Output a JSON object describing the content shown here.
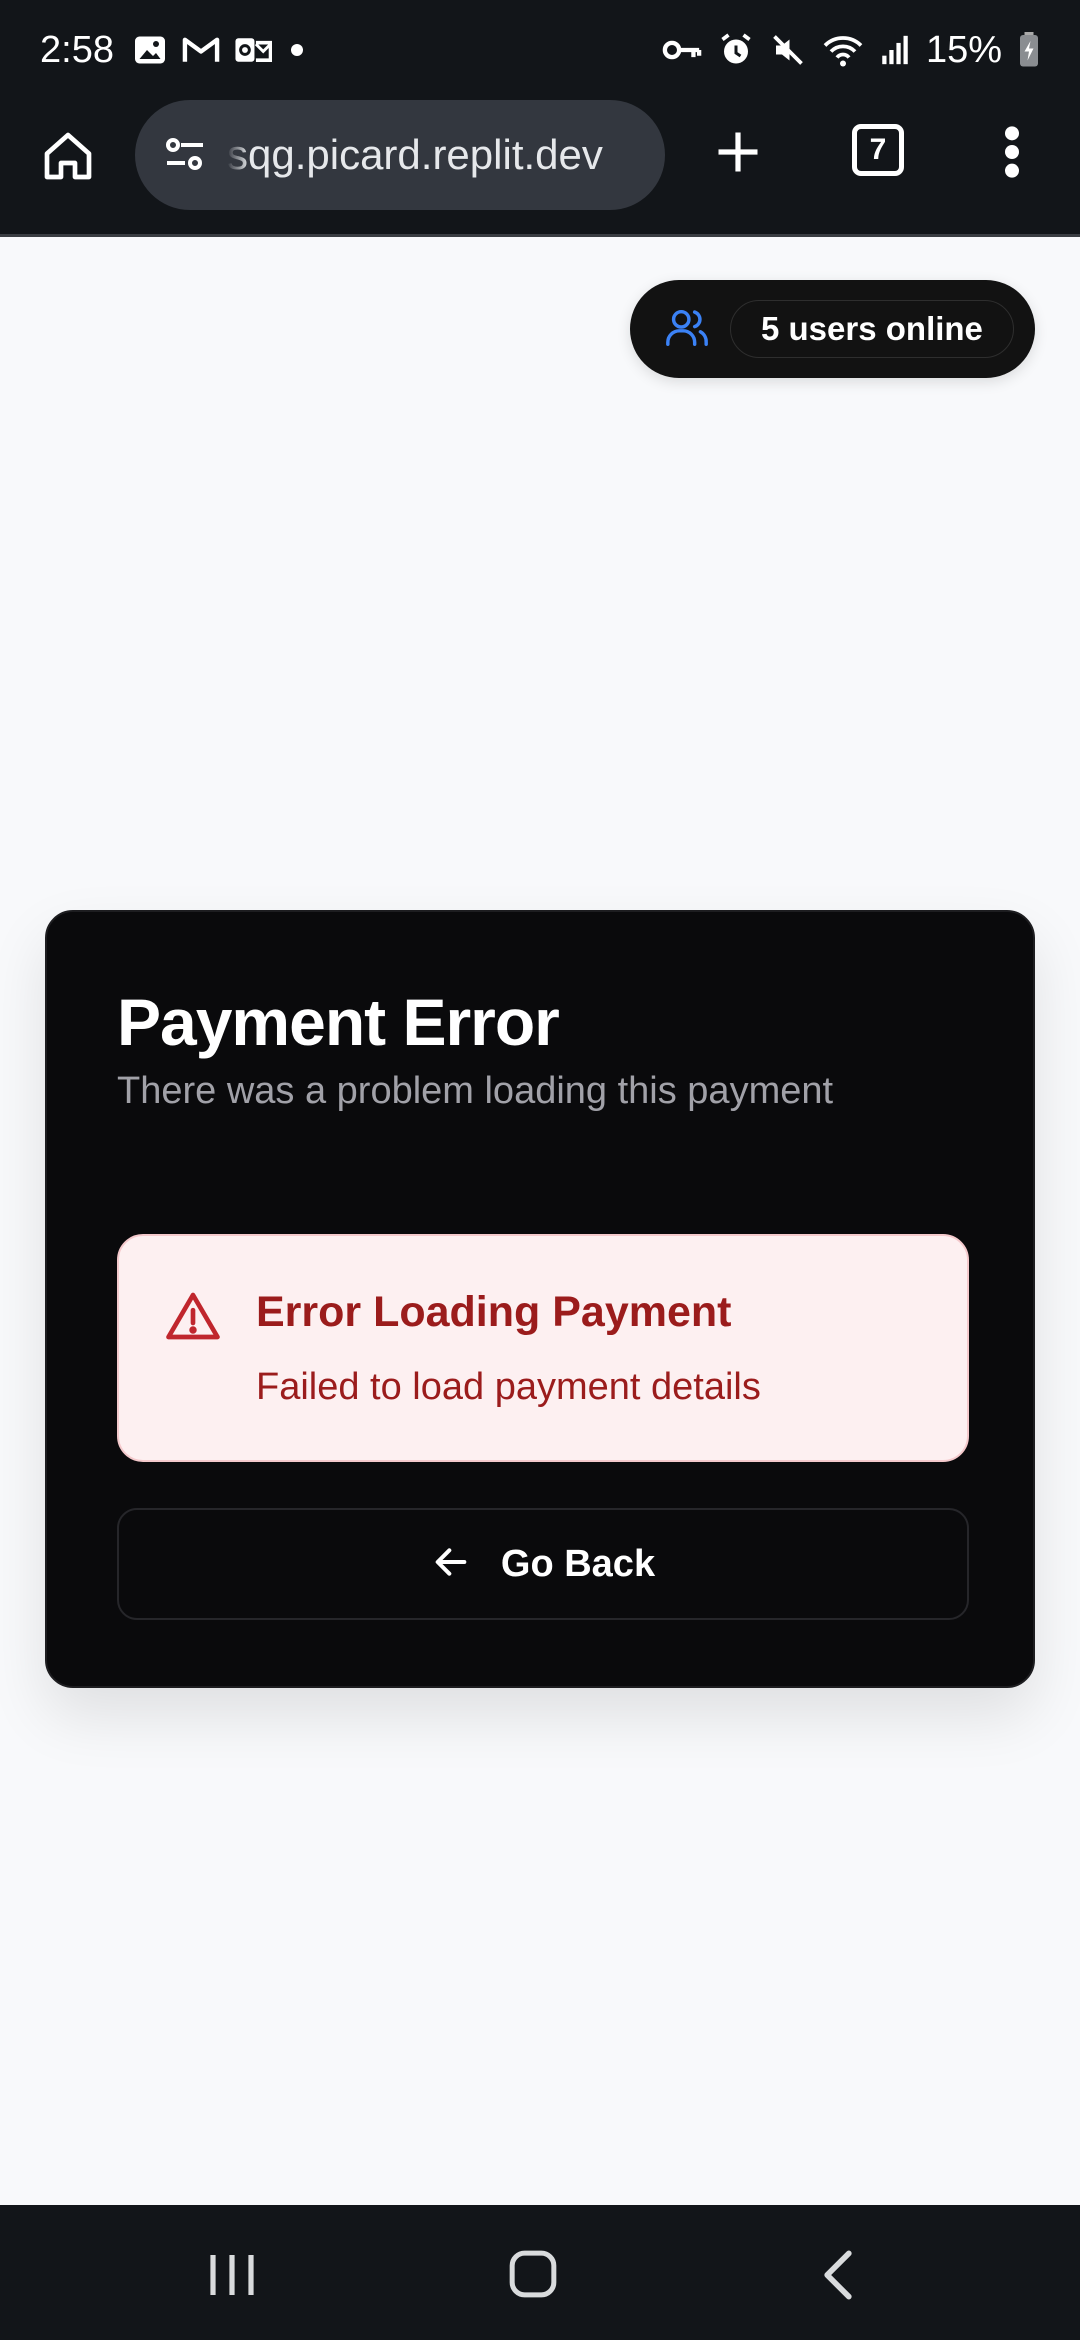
{
  "status_bar": {
    "time": "2:58",
    "battery": "15%",
    "left_icons": [
      "gallery-icon",
      "gmail-icon",
      "outlook-icon",
      "dot-icon"
    ],
    "right_icons": [
      "vpn-key-icon",
      "alarm-icon",
      "mute-icon",
      "wifi-icon",
      "signal-icon",
      "battery-charging-icon"
    ]
  },
  "browser": {
    "url": "sqg.picard.replit.dev",
    "tab_count": "7"
  },
  "presence": {
    "label": "5 users online",
    "icon_color": "#3b82f6"
  },
  "card": {
    "title": "Payment Error",
    "subtitle": "There was a problem loading this payment",
    "alert": {
      "title": "Error Loading Payment",
      "description": "Failed to load payment details",
      "color": "#9b1c1c",
      "background": "#fdf0f1"
    },
    "back_button": {
      "label": "Go Back"
    }
  },
  "nav_bar": {
    "items": [
      "recents-icon",
      "home-icon",
      "back-icon"
    ]
  }
}
